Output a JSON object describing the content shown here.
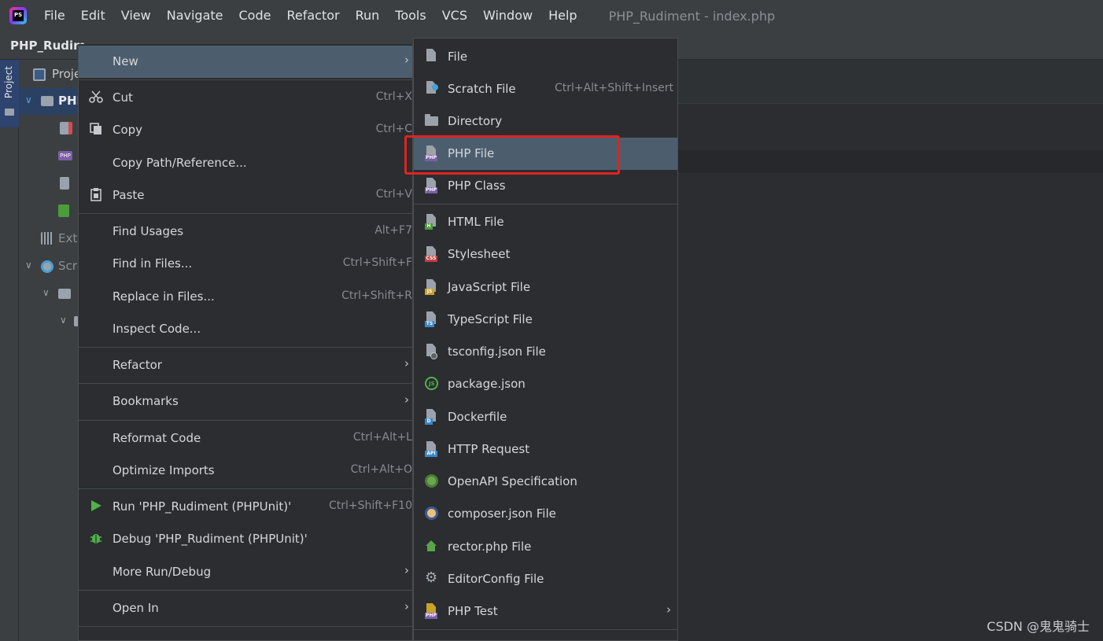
{
  "app": {
    "logo_text": "PS",
    "menu": [
      "File",
      "Edit",
      "View",
      "Navigate",
      "Code",
      "Refactor",
      "Run",
      "Tools",
      "VCS",
      "Window",
      "Help"
    ],
    "window_title": "PHP_Rudiment - index.php"
  },
  "navbar": {
    "project": "PHP_Rudim"
  },
  "toolstrip": {
    "project_tab": "Project"
  },
  "project_panel": {
    "rows": [
      {
        "label": "Proje",
        "icon": "project-view-icon"
      },
      {
        "label": "PHP",
        "icon": "folder-icon",
        "selected": true
      },
      {
        "label": "",
        "icon": "edit-file-icon"
      },
      {
        "label": "",
        "icon": "php-file-icon"
      },
      {
        "label": "",
        "icon": "file-icon"
      },
      {
        "label": "",
        "icon": "html-file-icon"
      },
      {
        "label": "Exte",
        "icon": "libraries-icon"
      },
      {
        "label": "Scra",
        "icon": "scratches-icon"
      }
    ]
  },
  "context_menu": {
    "items": [
      {
        "label": "New",
        "shortcut": "",
        "submenu": true,
        "active": true
      },
      {
        "label": "Cut",
        "shortcut": "Ctrl+X",
        "icon": "scissors-icon"
      },
      {
        "label": "Copy",
        "shortcut": "Ctrl+C",
        "icon": "copy-icon"
      },
      {
        "label": "Copy Path/Reference...",
        "shortcut": ""
      },
      {
        "label": "Paste",
        "shortcut": "Ctrl+V",
        "icon": "clipboard-icon"
      },
      {
        "label": "Find Usages",
        "shortcut": "Alt+F7"
      },
      {
        "label": "Find in Files...",
        "shortcut": "Ctrl+Shift+F"
      },
      {
        "label": "Replace in Files...",
        "shortcut": "Ctrl+Shift+R"
      },
      {
        "label": "Inspect Code...",
        "shortcut": ""
      },
      {
        "label": "Refactor",
        "shortcut": "",
        "submenu": true
      },
      {
        "label": "Bookmarks",
        "shortcut": "",
        "submenu": true
      },
      {
        "label": "Reformat Code",
        "shortcut": "Ctrl+Alt+L"
      },
      {
        "label": "Optimize Imports",
        "shortcut": "Ctrl+Alt+O"
      },
      {
        "label": "Run 'PHP_Rudiment (PHPUnit)'",
        "shortcut": "Ctrl+Shift+F10",
        "icon": "run-icon"
      },
      {
        "label": "Debug 'PHP_Rudiment (PHPUnit)'",
        "shortcut": "",
        "icon": "debug-icon"
      },
      {
        "label": "More Run/Debug",
        "shortcut": "",
        "submenu": true
      },
      {
        "label": "Open In",
        "shortcut": "",
        "submenu": true
      }
    ]
  },
  "new_submenu": {
    "items": [
      {
        "label": "File",
        "shortcut": "",
        "icon": "file-icon"
      },
      {
        "label": "Scratch File",
        "shortcut": "Ctrl+Alt+Shift+Insert",
        "icon": "scratch-file-icon"
      },
      {
        "label": "Directory",
        "shortcut": "",
        "icon": "folder-icon"
      },
      {
        "label": "PHP File",
        "shortcut": "",
        "icon": "php-file-icon",
        "active": true
      },
      {
        "label": "PHP Class",
        "shortcut": "",
        "icon": "php-class-icon"
      },
      {
        "label": "HTML File",
        "shortcut": "",
        "icon": "html-file-icon"
      },
      {
        "label": "Stylesheet",
        "shortcut": "",
        "icon": "css-file-icon"
      },
      {
        "label": "JavaScript File",
        "shortcut": "",
        "icon": "javascript-file-icon"
      },
      {
        "label": "TypeScript File",
        "shortcut": "",
        "icon": "typescript-file-icon"
      },
      {
        "label": "tsconfig.json File",
        "shortcut": "",
        "icon": "tsconfig-file-icon"
      },
      {
        "label": "package.json",
        "shortcut": "",
        "icon": "nodejs-icon"
      },
      {
        "label": "Dockerfile",
        "shortcut": "",
        "icon": "dockerfile-icon"
      },
      {
        "label": "HTTP Request",
        "shortcut": "",
        "icon": "api-file-icon"
      },
      {
        "label": "OpenAPI Specification",
        "shortcut": "",
        "icon": "openapi-icon"
      },
      {
        "label": "composer.json File",
        "shortcut": "",
        "icon": "composer-icon"
      },
      {
        "label": "rector.php File",
        "shortcut": "",
        "icon": "house-icon"
      },
      {
        "label": "EditorConfig File",
        "shortcut": "",
        "icon": "gear-icon"
      },
      {
        "label": "PHP Test",
        "shortcut": "",
        "icon": "php-test-icon",
        "submenu": true
      }
    ]
  },
  "watermark": "CSDN @鬼鬼骑士",
  "colors": {
    "php": "#7b5ea7",
    "html": "#4a9d3a",
    "css": "#c23f3f",
    "js": "#c9a227",
    "ts": "#3a87c8",
    "highlight": "#4c5e6e",
    "annotation": "#e0231f"
  }
}
